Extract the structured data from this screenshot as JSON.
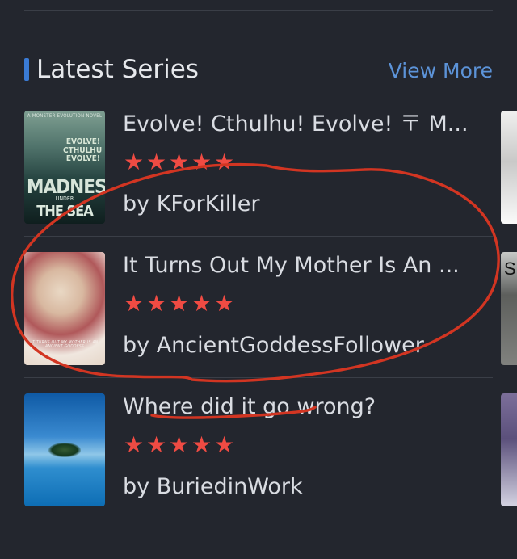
{
  "section": {
    "title": "Latest Series",
    "view_more": "View More"
  },
  "series": [
    {
      "title": "Evolve! Cthulhu! Evolve! 〒 M...",
      "author": "by KForKiller",
      "rating": 5,
      "cover": {
        "top": "A MONSTER-EVOLUTION NOVEL",
        "middle": "EVOLVE! CTHULHU EVOLVE!",
        "main": "MADNESS",
        "under": "UNDER",
        "sub": "THE SEA"
      }
    },
    {
      "title": "It Turns Out My Mother Is An ...",
      "author": "by AncientGoddessFollower",
      "rating": 5,
      "cover": {
        "text": "IT TURNS OUT MY MOTHER IS AN ANCIENT GODDESS"
      },
      "peek_letter": "S"
    },
    {
      "title": "Where did it go wrong?",
      "author": "by BuriedinWork",
      "rating": 5
    }
  ],
  "ui": {
    "star_glyph": "★",
    "accent_color": "#3a7bd5",
    "view_more_color": "#5c93d8",
    "star_color": "#ef4b43",
    "annotation_color": "#d23522"
  }
}
